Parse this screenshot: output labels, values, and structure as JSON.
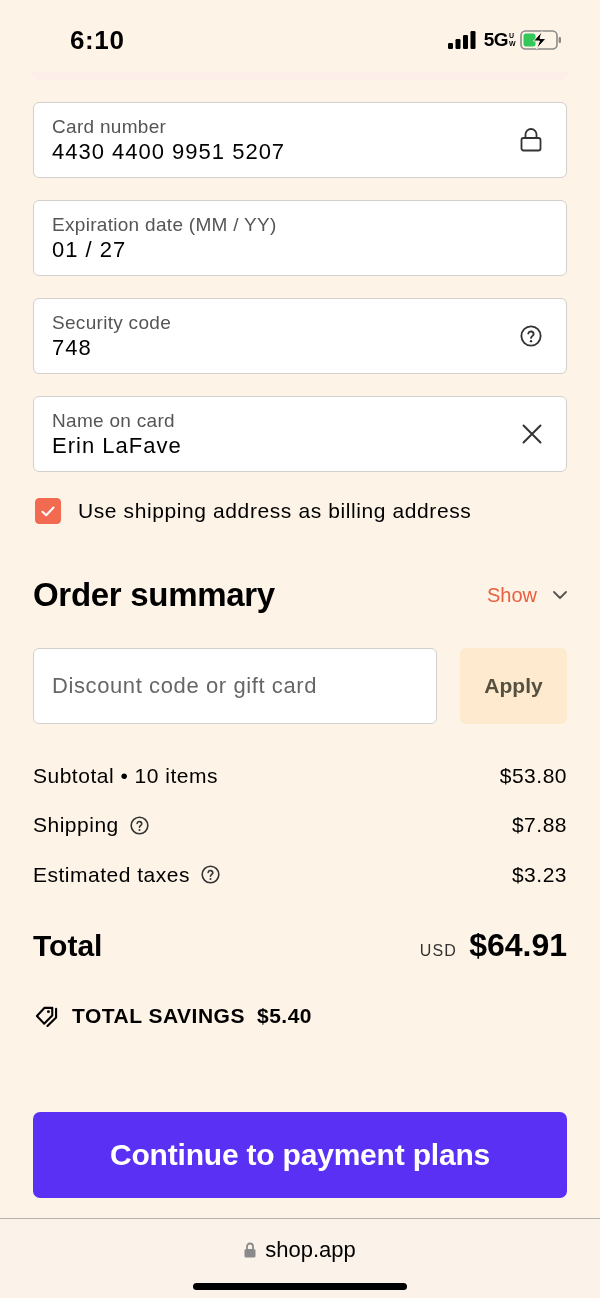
{
  "status_bar": {
    "time": "6:10",
    "network": "5G",
    "network_suffix": "UW"
  },
  "payment_fields": [
    {
      "kind": "lock",
      "label": "Card number",
      "value": "4430 4400 9951 5207"
    },
    {
      "kind": "plain",
      "label": "Expiration date (MM / YY)",
      "value": "01 / 27"
    },
    {
      "kind": "help",
      "label": "Security code",
      "value": "748"
    },
    {
      "kind": "clear",
      "label": "Name on card",
      "value": "Erin LaFave"
    }
  ],
  "billing_checkbox": {
    "label": "Use shipping address as billing address",
    "checked": true
  },
  "order_summary": {
    "title": "Order summary",
    "toggle": "Show",
    "expanded": false
  },
  "discount": {
    "placeholder": "Discount code or gift card",
    "button": "Apply"
  },
  "lines": [
    {
      "label": "Subtotal • 10 items",
      "amount": "$53.80",
      "info": false
    },
    {
      "label": "Shipping",
      "amount": "$7.88",
      "info": true
    },
    {
      "label": "Estimated taxes",
      "amount": "$3.23",
      "info": true
    }
  ],
  "total": {
    "label": "Total",
    "currency": "USD",
    "amount": "$64.91"
  },
  "savings": {
    "label": "TOTAL SAVINGS",
    "amount": "$5.40"
  },
  "continue_button": "Continue to payment plans",
  "browser_bar": {
    "url": "shop.app"
  }
}
